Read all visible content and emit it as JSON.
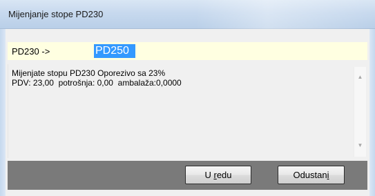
{
  "window": {
    "title": "Mijenjanje stope PD230"
  },
  "rate": {
    "label": "PD230 ->",
    "value": "PD250"
  },
  "info": {
    "lines": [
      "Mijenjate stopu PD230 Oporezivo sa 23%",
      "PDV: 23,00  potrošnja: 0,00  ambalaža:0,0000"
    ]
  },
  "scrollbar": {
    "up_icon": "▲",
    "down_icon": "▼"
  },
  "buttons": {
    "ok_prefix": "U ",
    "ok_mnemonic": "r",
    "ok_suffix": "edu",
    "cancel_prefix": "Odustan",
    "cancel_mnemonic": "i"
  },
  "colors": {
    "selection": "#3399ff",
    "input_bg": "#ffffe1",
    "button_bar": "#7a7a7a"
  }
}
